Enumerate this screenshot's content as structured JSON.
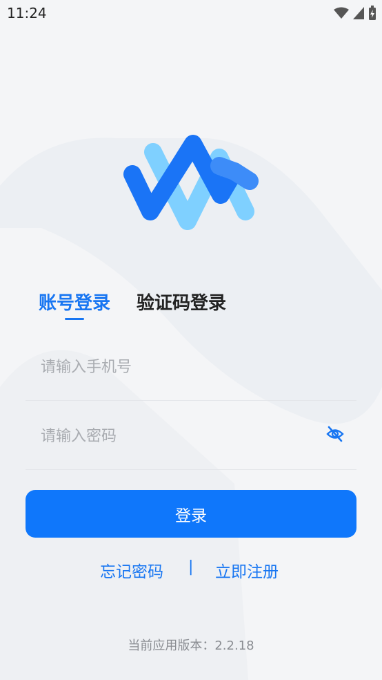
{
  "status_bar": {
    "time": "11:24"
  },
  "logo": {
    "icon": "app-logo-w",
    "colors": [
      "#1a6ff5",
      "#7fd0ff"
    ]
  },
  "tabs": [
    {
      "label": "账号登录",
      "active": true
    },
    {
      "label": "验证码登录",
      "active": false
    }
  ],
  "form": {
    "phone_placeholder": "请输入手机号",
    "password_placeholder": "请输入密码",
    "password_toggle_icon": "eye-off-icon"
  },
  "actions": {
    "login_label": "登录",
    "forgot_label": "忘记密码",
    "separator": "|",
    "register_label": "立即注册"
  },
  "footer": {
    "version_label": "当前应用版本：",
    "version_value": "2.2.18"
  },
  "colors": {
    "accent": "#1876f2",
    "button": "#0f77fb",
    "background": "#f4f5f7"
  }
}
